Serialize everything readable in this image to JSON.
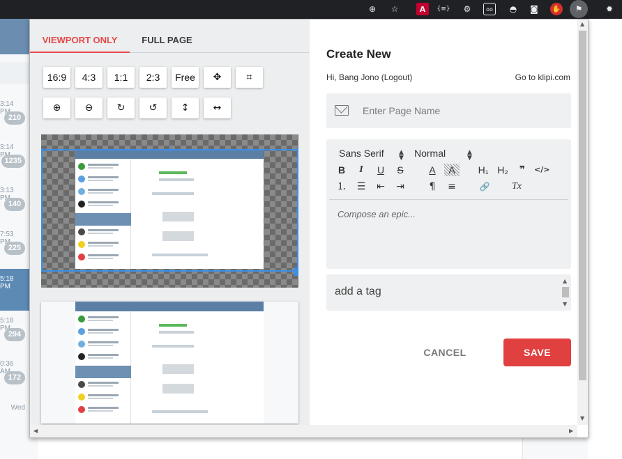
{
  "browser": {
    "extensions": [
      "plus-circle-icon",
      "star-icon",
      "angular-icon",
      "code-braces-icon",
      "gear-icon",
      "tape-icon",
      "spy-icon",
      "camera-icon",
      "stop-hand-icon",
      "bookmark-icon",
      "settings-icon"
    ],
    "code_ext_label": "{≡}"
  },
  "background_page": {
    "rows": [
      {
        "time": "3:14 PM",
        "badge": "210"
      },
      {
        "time": "3:14 PM",
        "badge": "1235"
      },
      {
        "time": "3:13 PM",
        "badge": "140"
      },
      {
        "time": "7:53 PM",
        "badge": "225"
      },
      {
        "time": "5:18 PM",
        "badge": ""
      },
      {
        "time": "5:18 PM",
        "badge": "294"
      },
      {
        "time": "0:36 AM",
        "badge": "172"
      },
      {
        "time": "Wed",
        "badge": ""
      }
    ]
  },
  "capture": {
    "tabs": [
      {
        "label": "VIEWPORT ONLY",
        "active": true
      },
      {
        "label": "FULL PAGE",
        "active": false
      }
    ],
    "ratio_buttons": [
      "16:9",
      "4:3",
      "1:1",
      "2:3",
      "Free"
    ],
    "tool_icons_row1": [
      "move-icon",
      "crop-icon"
    ],
    "tool_icons_row2": [
      "zoom-in-icon",
      "zoom-out-icon",
      "rotate-right-icon",
      "rotate-left-icon",
      "flip-vertical-icon",
      "flip-horizontal-icon"
    ]
  },
  "form": {
    "title": "Create New",
    "greeting": "Hi, Bang Jono (Logout)",
    "goto_link": "Go to klipi.com",
    "page_name_placeholder": "Enter Page Name",
    "font_select": "Sans Serif",
    "size_select": "Normal",
    "compose_placeholder": "Compose an epic...",
    "tag_placeholder": "add a tag",
    "cancel_label": "CANCEL",
    "save_label": "SAVE",
    "toolbar": {
      "bold": "B",
      "italic": "I",
      "underline": "U",
      "strike": "S",
      "color": "A",
      "bg": "A",
      "h1": "H₁",
      "h2": "H₂",
      "quote": "❞",
      "code": "</>",
      "ol": "⒈",
      "ul": "☰",
      "outdent": "⇤",
      "indent": "⇥",
      "rtl": "¶",
      "align": "≡",
      "link": "🔗",
      "clean": "Tx"
    },
    "accent_color": "#e0403f"
  }
}
